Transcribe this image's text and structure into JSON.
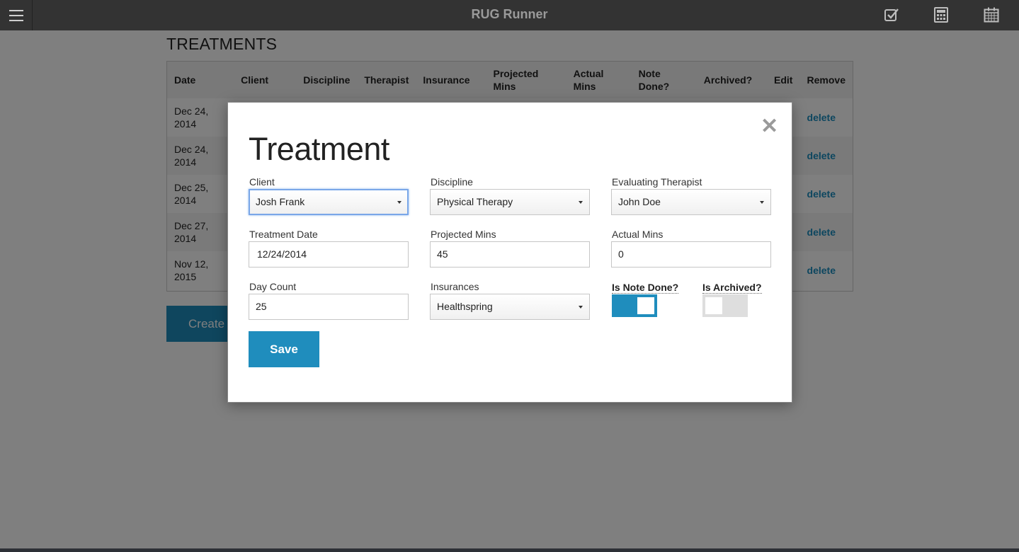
{
  "app": {
    "title": "RUG Runner"
  },
  "topbar_icons": [
    "menu-icon",
    "checkbox-icon",
    "calculator-icon",
    "calendar-icon"
  ],
  "page": {
    "heading": "TREATMENTS",
    "create_label": "Create"
  },
  "table": {
    "headers": [
      "Date",
      "Client",
      "Discipline",
      "Therapist",
      "Insurance",
      "Projected Mins",
      "Actual Mins",
      "Note Done?",
      "Archived?",
      "Edit",
      "Remove"
    ],
    "rows": [
      {
        "date": "Dec 24, 2014",
        "remove": "delete"
      },
      {
        "date": "Dec 24, 2014",
        "remove": "delete"
      },
      {
        "date": "Dec 25, 2014",
        "remove": "delete"
      },
      {
        "date": "Dec 27, 2014",
        "remove": "delete"
      },
      {
        "date": "Nov 12, 2015",
        "remove": "delete"
      }
    ]
  },
  "modal": {
    "title": "Treatment",
    "close": "✕",
    "client": {
      "label": "Client",
      "value": "Josh Frank"
    },
    "discipline": {
      "label": "Discipline",
      "value": "Physical Therapy"
    },
    "therapist": {
      "label": "Evaluating Therapist",
      "value": "John Doe"
    },
    "treatment_date": {
      "label": "Treatment Date",
      "value": "12/24/2014"
    },
    "projected_mins": {
      "label": "Projected Mins",
      "value": "45"
    },
    "actual_mins": {
      "label": "Actual Mins",
      "value": "0"
    },
    "day_count": {
      "label": "Day Count",
      "value": "25"
    },
    "insurances": {
      "label": "Insurances",
      "value": "Healthspring"
    },
    "note_done": {
      "label": "Is Note Done?",
      "on": true
    },
    "archived": {
      "label": "Is Archived?",
      "on": false
    },
    "save_label": "Save"
  },
  "colors": {
    "accent": "#1f8dbd",
    "topbar": "#333333",
    "link": "#1a8dbf"
  }
}
